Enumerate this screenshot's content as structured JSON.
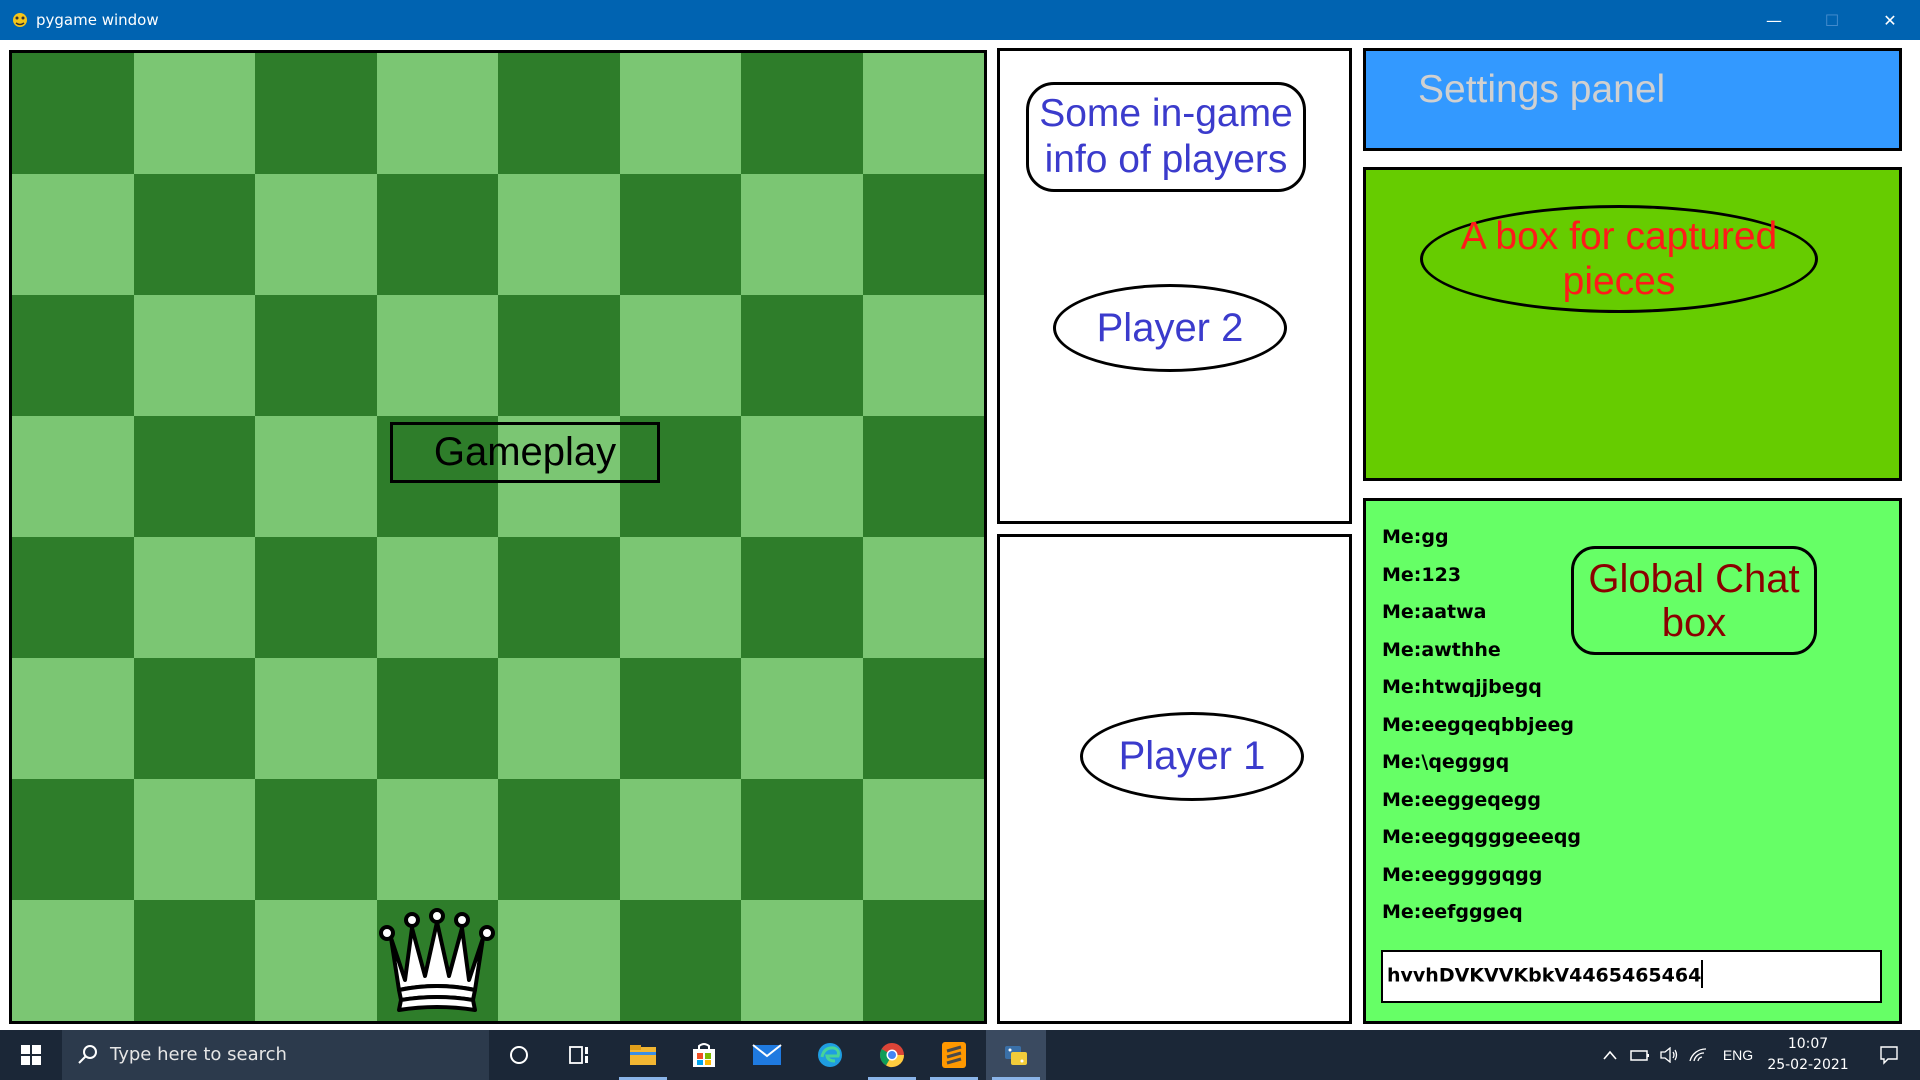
{
  "window": {
    "title": "pygame window",
    "minimize_glyph": "—",
    "maximize_glyph": "☐",
    "close_glyph": "✕"
  },
  "board": {
    "label": "Gameplay",
    "piece": "white-queen",
    "colors": {
      "dark": "#2e7d2a",
      "light": "#7bc673"
    }
  },
  "info": {
    "label_line1": "Some in-game",
    "label_line2": "info of players",
    "player2": "Player 2",
    "player1": "Player 1"
  },
  "settings": {
    "label": "Settings panel",
    "color": "#3399ff"
  },
  "captured": {
    "label_line1": "A box for captured",
    "label_line2": "pieces",
    "color": "#66cc00"
  },
  "chat": {
    "title_line1": "Global Chat",
    "title_line2": "box",
    "messages": [
      "Me:gg",
      "Me:123",
      "Me:aatwa",
      "Me:awthhe",
      "Me:htwqjjbegq",
      "Me:eegqeqbbjeeg",
      "Me:\\qegggq",
      "Me:eeggeqegg",
      "Me:eegqgggeeeqg",
      "Me:eeggggqgg",
      "Me:eefgggeq"
    ],
    "input_value": "hvvhDVKVVKbkV4465465464",
    "color": "#66ff66"
  },
  "taskbar": {
    "search_placeholder": "Type here to search",
    "apps": [
      "start-icon",
      "cortana-icon",
      "task-view-icon",
      "file-explorer-icon",
      "store-icon",
      "mail-icon",
      "edge-icon",
      "chrome-icon",
      "sublime-text-icon",
      "python-icon"
    ],
    "tray": {
      "chevron": "^",
      "language": "ENG",
      "time": "10:07",
      "date": "25-02-2021"
    }
  }
}
